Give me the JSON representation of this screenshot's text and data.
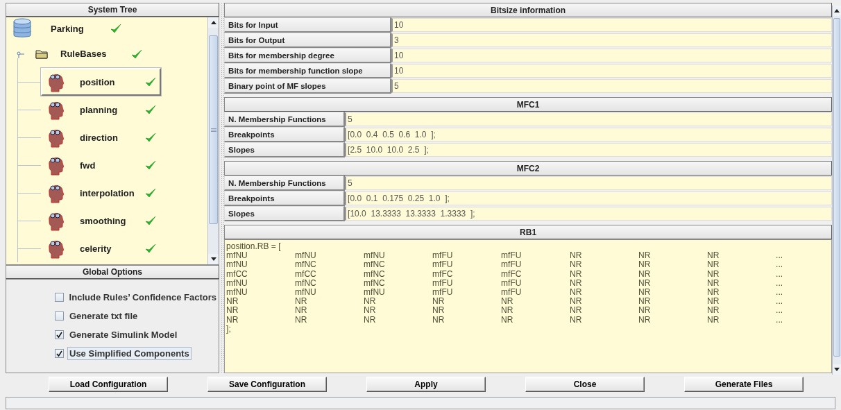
{
  "system_tree": {
    "title": "System Tree",
    "items": [
      {
        "label": "Parking",
        "kind": "database",
        "valid": true,
        "selected": false,
        "children": [
          {
            "label": "RuleBases",
            "kind": "folder",
            "valid": true,
            "selected": false,
            "expanded": true,
            "children": [
              {
                "label": "position",
                "kind": "rulebase",
                "valid": true,
                "selected": true
              },
              {
                "label": "planning",
                "kind": "rulebase",
                "valid": true,
                "selected": false
              },
              {
                "label": "direction",
                "kind": "rulebase",
                "valid": true,
                "selected": false
              },
              {
                "label": "fwd",
                "kind": "rulebase",
                "valid": true,
                "selected": false
              },
              {
                "label": "interpolation",
                "kind": "rulebase",
                "valid": true,
                "selected": false
              },
              {
                "label": "smoothing",
                "kind": "rulebase",
                "valid": true,
                "selected": false
              },
              {
                "label": "celerity",
                "kind": "rulebase",
                "valid": true,
                "selected": false
              }
            ]
          }
        ]
      }
    ]
  },
  "global_options": {
    "title": "Global Options",
    "options": [
      {
        "label": "Include Rules’ Confidence Factors",
        "checked": false,
        "focused": false
      },
      {
        "label": "Generate txt file",
        "checked": false,
        "focused": false
      },
      {
        "label": "Generate Simulink Model",
        "checked": true,
        "focused": false
      },
      {
        "label": "Use Simplified Components",
        "checked": true,
        "focused": true
      }
    ]
  },
  "sections": [
    {
      "title": "Bitsize information",
      "kind": "wide",
      "fields": [
        {
          "label": "Bits for Input",
          "value": "10"
        },
        {
          "label": "Bits for Output",
          "value": "3"
        },
        {
          "label": "Bits for membership degree",
          "value": "10"
        },
        {
          "label": "Bits for membership function slope",
          "value": "10"
        },
        {
          "label": "Binary point of MF slopes",
          "value": "5"
        }
      ]
    },
    {
      "title": "MFC1",
      "kind": "narrow",
      "fields": [
        {
          "label": "N. Membership Functions",
          "value": "5"
        },
        {
          "label": "Breakpoints",
          "value": "[0.0  0.4  0.5  0.6  1.0  ];"
        },
        {
          "label": "Slopes",
          "value": "[2.5  10.0  10.0  2.5  ];"
        }
      ]
    },
    {
      "title": "MFC2",
      "kind": "narrow",
      "fields": [
        {
          "label": "N. Membership Functions",
          "value": "5"
        },
        {
          "label": "Breakpoints",
          "value": "[0.0  0.1  0.175  0.25  1.0  ];"
        },
        {
          "label": "Slopes",
          "value": "[10.0  13.3333  13.3333  1.3333  ];"
        }
      ]
    }
  ],
  "rule_base": {
    "title": "RB1",
    "header": "position.RB = [",
    "rows": [
      [
        "mfNU",
        "mfNU",
        "mfNU",
        "mfFU",
        "mfFU",
        "NR",
        "NR",
        "NR",
        "..."
      ],
      [
        "mfNU",
        "mfNC",
        "mfNC",
        "mfFU",
        "mfFU",
        "NR",
        "NR",
        "NR",
        "..."
      ],
      [
        "mfCC",
        "mfCC",
        "mfNC",
        "mfFC",
        "mfFC",
        "NR",
        "NR",
        "NR",
        "..."
      ],
      [
        "mfNU",
        "mfNC",
        "mfNC",
        "mfFU",
        "mfFU",
        "NR",
        "NR",
        "NR",
        "..."
      ],
      [
        "mfNU",
        "mfNU",
        "mfNU",
        "mfFU",
        "mfFU",
        "NR",
        "NR",
        "NR",
        "..."
      ],
      [
        "NR",
        "NR",
        "NR",
        "NR",
        "NR",
        "NR",
        "NR",
        "NR",
        "..."
      ],
      [
        "NR",
        "NR",
        "NR",
        "NR",
        "NR",
        "NR",
        "NR",
        "NR",
        "..."
      ],
      [
        "NR",
        "NR",
        "NR",
        "NR",
        "NR",
        "NR",
        "NR",
        "NR",
        "..."
      ]
    ],
    "footer": "];"
  },
  "buttons": [
    "Load Configuration",
    "Save Configuration",
    "Apply",
    "Close",
    "Generate Files"
  ]
}
